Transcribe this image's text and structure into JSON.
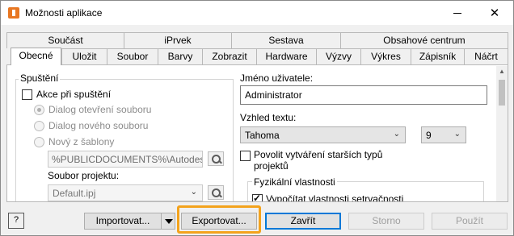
{
  "window": {
    "title": "Možnosti aplikace",
    "close_glyph": "✕"
  },
  "tabs_top": [
    "Součást",
    "iPrvek",
    "Sestava",
    "Obsahové centrum"
  ],
  "tabs_bottom": [
    "Obecné",
    "Uložit",
    "Soubor",
    "Barvy",
    "Zobrazit",
    "Hardware",
    "Výzvy",
    "Výkres",
    "Zápisník",
    "Náčrt"
  ],
  "active_tab": "Obecné",
  "startup": {
    "group_title": "Spuštění",
    "action_on_startup_label": "Akce při spuštění",
    "action_on_startup_checked": false,
    "radio_open_dialog": "Dialog otevření souboru",
    "radio_new_dialog": "Dialog nového souboru",
    "radio_from_template": "Nový z šablony",
    "template_path": "%PUBLICDOCUMENTS%\\Autodes",
    "project_file_label": "Soubor projektu:",
    "project_file_value": "Default.ipj"
  },
  "user": {
    "username_label": "Jméno uživatele:",
    "username_value": "Administrator"
  },
  "text_appearance": {
    "label": "Vzhled textu:",
    "font_value": "Tahoma",
    "size_value": "9",
    "legacy_types_label_line1": "Povolit vytváření starších typů",
    "legacy_types_label_line2": "projektů",
    "legacy_types_checked": false
  },
  "physical": {
    "group_title": "Fyzikální vlastnosti",
    "compute_inertia_label": "Vypočítat vlastnosti setrvačnosti",
    "compute_inertia_checked": true
  },
  "buttons": {
    "help": "?",
    "import": "Importovat...",
    "export": "Exportovat...",
    "close": "Zavřít",
    "cancel": "Storno",
    "apply": "Použít"
  },
  "colors": {
    "accent": "#0078d7",
    "highlight": "#f3a31d"
  }
}
